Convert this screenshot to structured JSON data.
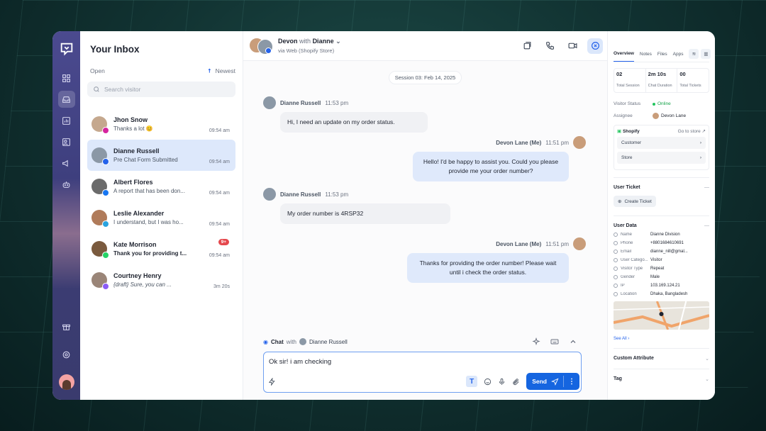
{
  "rail": {
    "items": [
      "grid-icon",
      "inbox-icon",
      "chart-icon",
      "contacts-icon",
      "megaphone-icon",
      "bot-icon"
    ],
    "bottom": [
      "gift-icon",
      "gear-icon"
    ]
  },
  "inbox": {
    "title": "Your Inbox",
    "filter": "Open",
    "sort": "Newest",
    "search_placeholder": "Search visitor",
    "conversations": [
      {
        "name": "Jhon Snow",
        "preview": "Thanks a lot 😊",
        "time": "09:54 am",
        "channel": "instagram",
        "avatar": "#c5a88e"
      },
      {
        "name": "Dianne Russell",
        "preview": "Pre Chat Form Submitted",
        "time": "09:54 am",
        "channel": "web",
        "avatar": "#8b98a6"
      },
      {
        "name": "Albert Flores",
        "preview": "A report that has been don...",
        "time": "09:54 am",
        "channel": "facebook",
        "avatar": "#6b6b6b"
      },
      {
        "name": "Leslie Alexander",
        "preview": "I understand, but I was ho...",
        "time": "09:54 am",
        "channel": "telegram",
        "avatar": "#b07b5a"
      },
      {
        "name": "Kate Morrison",
        "preview": "Thank you for providing t...",
        "time": "09:54 am",
        "channel": "whatsapp",
        "avatar": "#7a5a3e",
        "badge": "9+"
      },
      {
        "name": "Courtney Henry",
        "preview": "{draft} Sure, you can ...",
        "time": "3m 20s",
        "channel": "messenger",
        "avatar": "#9a8578"
      }
    ]
  },
  "chat": {
    "agent": "Devon",
    "with_word": "with",
    "visitor": "Dianne",
    "source": "via Web (Shopify Store)",
    "session": "Session 03: Feb 14, 2025",
    "messages": [
      {
        "from": "Dianne Russell",
        "time": "11:53 pm",
        "text": "Hi, I need an update on my order status.",
        "dir": "in"
      },
      {
        "from": "Devon Lane (Me)",
        "time": "11:51 pm",
        "text": "Hello! I'd be happy to assist you. Could you please provide me your order number?",
        "dir": "out"
      },
      {
        "from": "Dianne Russell",
        "time": "11:53 pm",
        "text": "My order number is 4RSP32",
        "dir": "in"
      },
      {
        "from": "Devon Lane (Me)",
        "time": "11:51 pm",
        "text": "Thanks for providing the order number! Please wait until i check the order status.",
        "dir": "out"
      }
    ],
    "composer": {
      "mode": "Chat",
      "with_word": "with",
      "target": "Dianne Russell",
      "value": "Ok sir! i am checking",
      "send": "Send"
    }
  },
  "details": {
    "tabs": [
      "Overview",
      "Notes",
      "Files",
      "Apps"
    ],
    "stats": [
      {
        "v": "02",
        "l": "Total Session"
      },
      {
        "v": "2m 10s",
        "l": "Chat Duration"
      },
      {
        "v": "00",
        "l": "Total Tickets"
      }
    ],
    "visitor_status_label": "Visitor Status",
    "visitor_status": "Online",
    "assignee_label": "Assignee",
    "assignee": "Devon Lane",
    "shop": {
      "name": "Shopify",
      "link": "Go to store",
      "items": [
        "Customer",
        "Store"
      ]
    },
    "user_ticket": "User Ticket",
    "create_ticket": "Create Ticket",
    "user_data": "User Data",
    "fields": [
      {
        "k": "Name",
        "v": "Dianne Division"
      },
      {
        "k": "Phone",
        "v": "+8801684610691"
      },
      {
        "k": "Email",
        "v": "dianne_nill@gmal..."
      },
      {
        "k": "User Catego...",
        "v": "Visitor"
      },
      {
        "k": "Visitor Type",
        "v": "Repeat"
      },
      {
        "k": "Gender",
        "v": "Male"
      },
      {
        "k": "IP",
        "v": "103.169.124.21"
      },
      {
        "k": "Location",
        "v": "Dhaka, Bangladesh"
      }
    ],
    "see_all": "See All",
    "custom_attribute": "Custom Attribute",
    "tag": "Tag"
  },
  "colors": {
    "accent": "#2563eb",
    "send": "#1565e0",
    "online": "#22c55e",
    "badge": "#e5484d"
  }
}
